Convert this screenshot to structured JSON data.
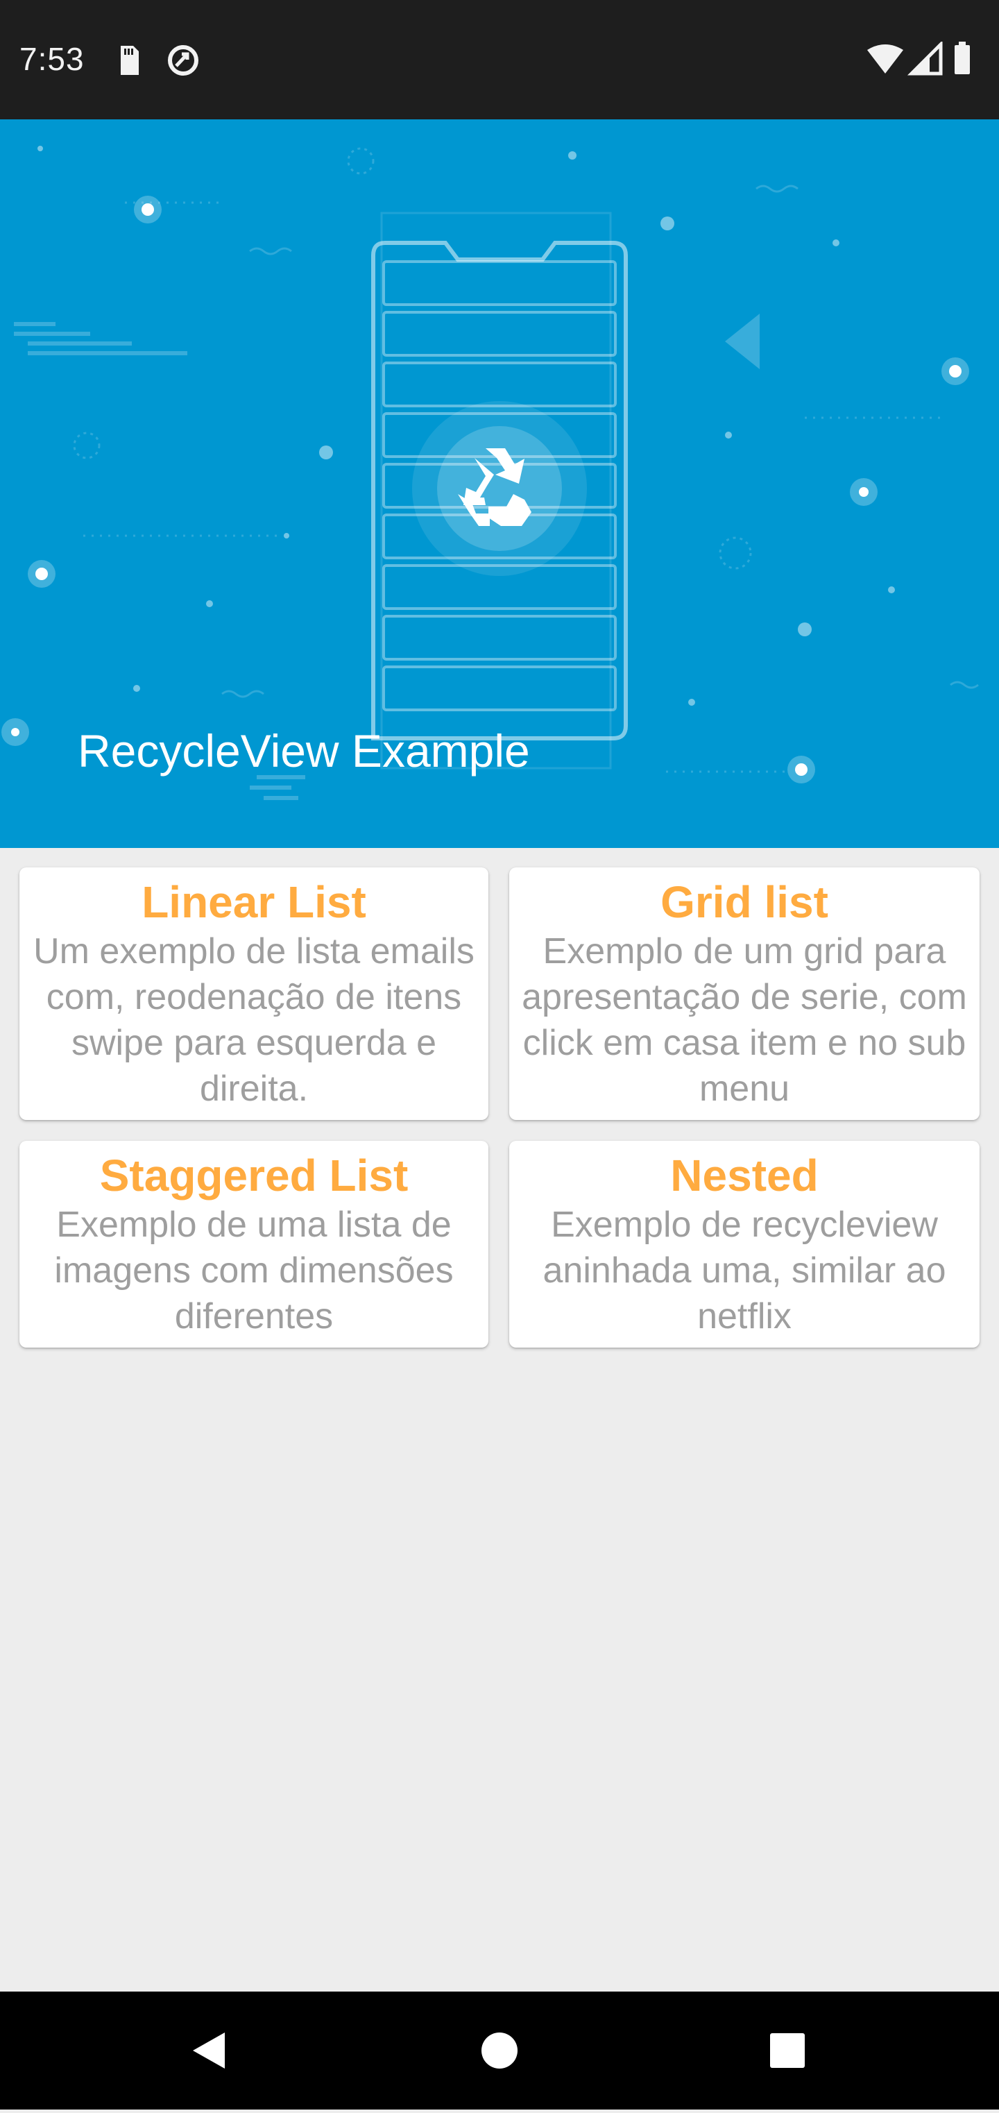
{
  "status_bar": {
    "time": "7:53",
    "left_icons": [
      "sd-card-icon",
      "data-saver-icon"
    ],
    "right_icons": [
      "wifi-icon",
      "cell-signal-icon",
      "battery-icon"
    ]
  },
  "hero": {
    "title": "RecycleView Example",
    "background_color": "#0097d1",
    "icon": "recycle-icon"
  },
  "cards": [
    {
      "title": "Linear List",
      "description": "Um exemplo de lista emails com, reodenação de itens swipe para esquerda e direita."
    },
    {
      "title": "Grid list",
      "description": "Exemplo de um grid para apresentação de serie, com click em casa item e no sub menu"
    },
    {
      "title": "Staggered List",
      "description": "Exemplo de uma lista de imagens com dimensões diferentes"
    },
    {
      "title": "Nested",
      "description": "Exemplo de recycleview aninhada uma, similar ao netflix"
    }
  ],
  "colors": {
    "accent": "#ffab40",
    "description_text": "#9e9e9e",
    "page_background": "#ededed"
  },
  "nav_bar": {
    "buttons": [
      "back-icon",
      "home-icon",
      "recents-icon"
    ]
  }
}
